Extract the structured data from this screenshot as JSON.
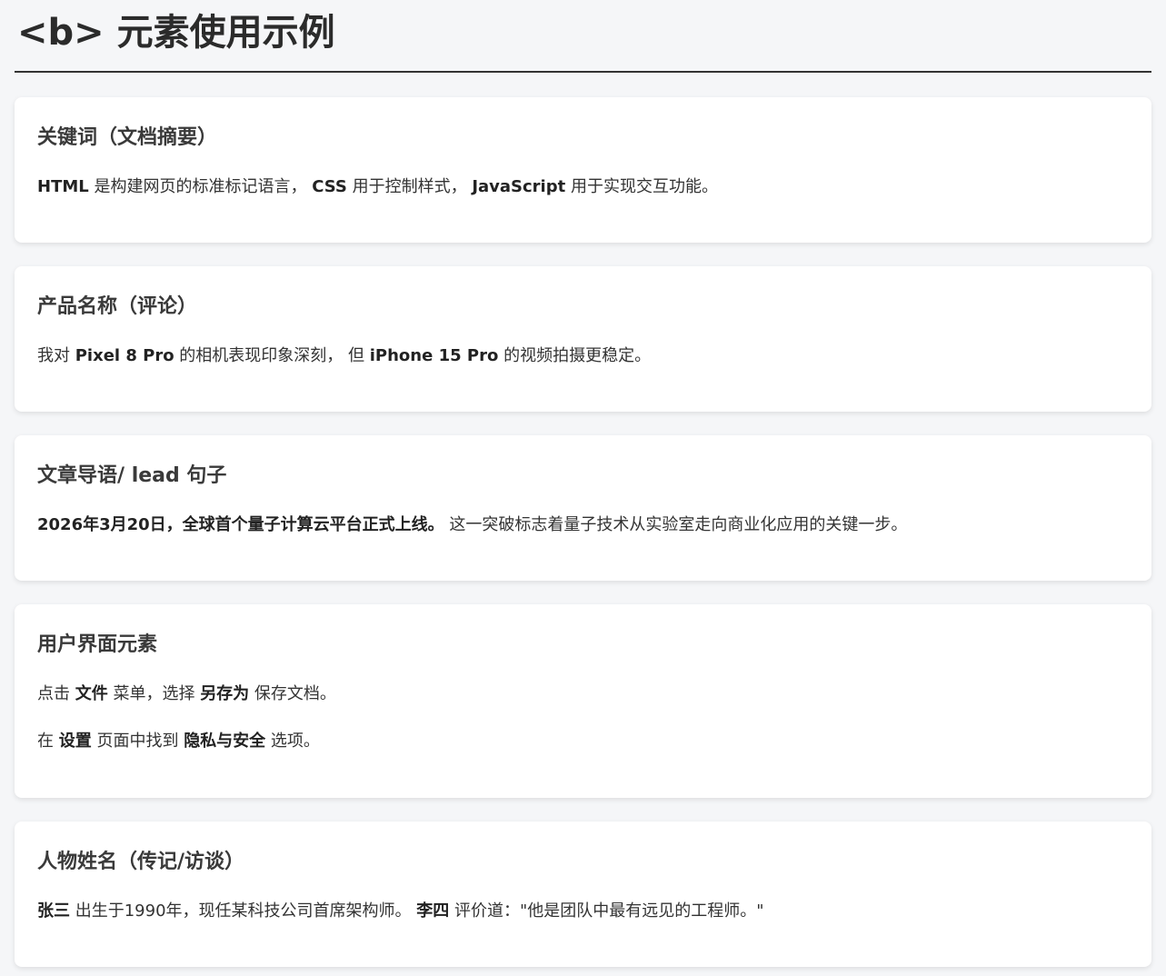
{
  "page": {
    "title": "<b> 元素使用示例"
  },
  "sections": [
    {
      "heading": "关键词（文档摘要）",
      "paragraphs": [
        {
          "runs": [
            {
              "text": "HTML",
              "bold": true
            },
            {
              "text": " 是构建网页的标准标记语言， ",
              "bold": false
            },
            {
              "text": "CSS",
              "bold": true
            },
            {
              "text": " 用于控制样式， ",
              "bold": false
            },
            {
              "text": "JavaScript",
              "bold": true
            },
            {
              "text": " 用于实现交互功能。",
              "bold": false
            }
          ]
        }
      ]
    },
    {
      "heading": "产品名称（评论）",
      "paragraphs": [
        {
          "runs": [
            {
              "text": "我对 ",
              "bold": false
            },
            {
              "text": "Pixel 8 Pro",
              "bold": true
            },
            {
              "text": " 的相机表现印象深刻， 但 ",
              "bold": false
            },
            {
              "text": "iPhone 15 Pro",
              "bold": true
            },
            {
              "text": " 的视频拍摄更稳定。",
              "bold": false
            }
          ]
        }
      ]
    },
    {
      "heading": "文章导语/ lead 句子",
      "paragraphs": [
        {
          "runs": [
            {
              "text": "2026年3月20日，全球首个量子计算云平台正式上线。",
              "bold": true
            },
            {
              "text": " 这一突破标志着量子技术从实验室走向商业化应用的关键一步。",
              "bold": false
            }
          ]
        }
      ]
    },
    {
      "heading": "用户界面元素",
      "paragraphs": [
        {
          "runs": [
            {
              "text": "点击 ",
              "bold": false
            },
            {
              "text": "文件",
              "bold": true
            },
            {
              "text": " 菜单，选择 ",
              "bold": false
            },
            {
              "text": "另存为",
              "bold": true
            },
            {
              "text": " 保存文档。",
              "bold": false
            }
          ]
        },
        {
          "runs": [
            {
              "text": "在 ",
              "bold": false
            },
            {
              "text": "设置",
              "bold": true
            },
            {
              "text": " 页面中找到 ",
              "bold": false
            },
            {
              "text": "隐私与安全",
              "bold": true
            },
            {
              "text": " 选项。",
              "bold": false
            }
          ]
        }
      ]
    },
    {
      "heading": "人物姓名（传记/访谈）",
      "paragraphs": [
        {
          "runs": [
            {
              "text": "张三",
              "bold": true
            },
            {
              "text": " 出生于1990年，现任某科技公司首席架构师。 ",
              "bold": false
            },
            {
              "text": "李四",
              "bold": true
            },
            {
              "text": " 评价道：\"他是团队中最有远见的工程师。\"",
              "bold": false
            }
          ]
        }
      ]
    }
  ]
}
